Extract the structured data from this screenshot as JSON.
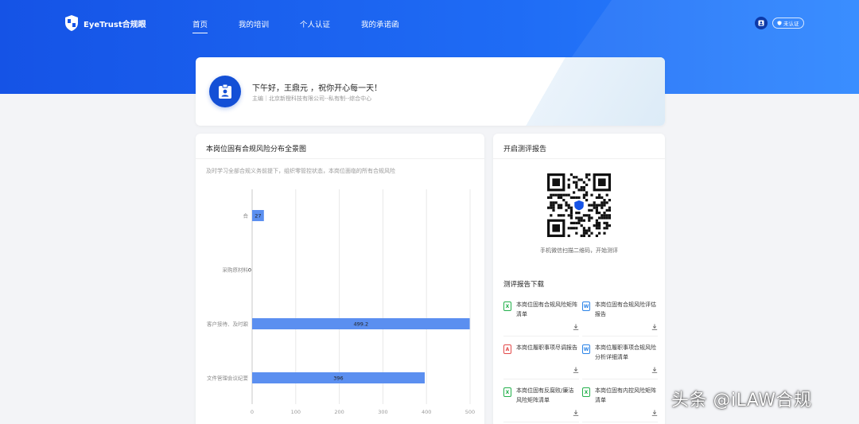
{
  "header": {
    "logo_text": "EyeTrust合规眼",
    "nav": [
      {
        "label": "首页"
      },
      {
        "label": "我的培训"
      },
      {
        "label": "个人认证"
      },
      {
        "label": "我的承诺函"
      }
    ],
    "cert_badge": "未认证"
  },
  "greeting": {
    "title": "下午好，王鼎元 ，祝你开心每一天！",
    "subtitle": "主编｜北京新橙科技有限公司--私有制--综合中心"
  },
  "risk_panel": {
    "title": "本岗位固有合规风险分布全景图",
    "description": "及时学习全部合规义务前提下，组织零管控状态，本岗位面临的所有合规风险"
  },
  "chart_data": {
    "type": "bar",
    "orientation": "horizontal",
    "categories": [
      "合",
      "采购原材料",
      "客户接待、及时跟",
      "文件管理会议纪要"
    ],
    "values": [
      27,
      0,
      499.2,
      396
    ],
    "value_labels": [
      "27",
      "0",
      "499.2",
      "396"
    ],
    "x_ticks": [
      "0",
      "100",
      "200",
      "300",
      "400",
      "500"
    ],
    "xlim": [
      0,
      500
    ],
    "grid": true,
    "bar_color": "#5b8ff0"
  },
  "report_panel": {
    "title": "开启测评报告",
    "qr_caption": "手机微信扫描二维码，开始测评",
    "download_title": "测评报告下载",
    "files": [
      {
        "name": "本岗位固有合规风险矩阵清单",
        "type": "X",
        "color": "#23b04b"
      },
      {
        "name": "本岗位固有合规风险评估报告",
        "type": "W",
        "color": "#2b84e8"
      },
      {
        "name": "本岗位履职事项尽调报告",
        "type": "A",
        "color": "#e34a4a"
      },
      {
        "name": "本岗位履职事项合规风险分析详细清单",
        "type": "W",
        "color": "#2b84e8"
      },
      {
        "name": "本岗位固有反腐败/廉洁风险矩阵清单",
        "type": "X",
        "color": "#23b04b"
      },
      {
        "name": "本岗位固有内控风险矩阵清单",
        "type": "X",
        "color": "#23b04b"
      }
    ]
  },
  "watermark": "头条 @iLAW合规",
  "colors": {
    "brand_blue": "#1553e6",
    "bar": "#5b8ff0"
  }
}
